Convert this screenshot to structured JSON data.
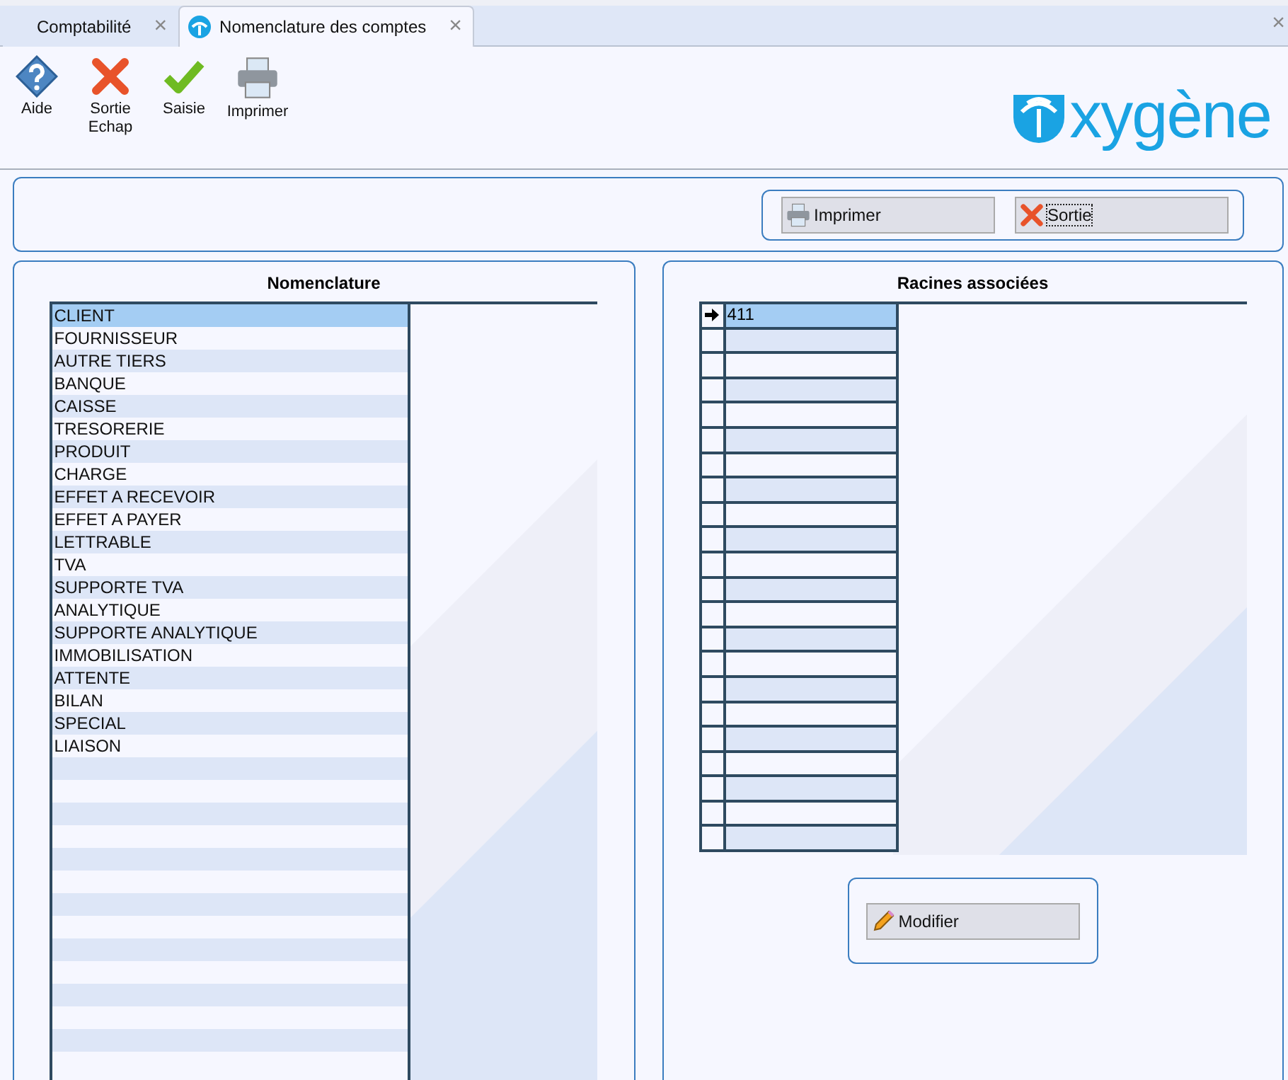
{
  "tabs": [
    {
      "label": "Comptabilité",
      "selected": false,
      "close": "×"
    },
    {
      "label": "Nomenclature des comptes",
      "selected": true,
      "close": "×"
    }
  ],
  "window_close": "×",
  "toolbar": [
    {
      "kind": "help",
      "label": "Aide"
    },
    {
      "kind": "exit",
      "label": "Sortie\nEchap"
    },
    {
      "kind": "check",
      "label": "Saisie"
    },
    {
      "kind": "print",
      "label": "Imprimer"
    }
  ],
  "logo_text": "xygène",
  "top_buttons": [
    {
      "kind": "print",
      "label": "Imprimer",
      "focused": false
    },
    {
      "kind": "exit",
      "label": "Sortie",
      "focused": true
    }
  ],
  "nomenclature": {
    "title": "Nomenclature",
    "items": [
      {
        "label": "CLIENT",
        "selected": true
      },
      {
        "label": "FOURNISSEUR",
        "selected": false
      },
      {
        "label": "AUTRE TIERS",
        "selected": false
      },
      {
        "label": "BANQUE",
        "selected": false
      },
      {
        "label": "CAISSE",
        "selected": false
      },
      {
        "label": "TRESORERIE",
        "selected": false
      },
      {
        "label": "PRODUIT",
        "selected": false
      },
      {
        "label": "CHARGE",
        "selected": false
      },
      {
        "label": "EFFET A RECEVOIR",
        "selected": false
      },
      {
        "label": "EFFET A PAYER",
        "selected": false
      },
      {
        "label": "LETTRABLE",
        "selected": false
      },
      {
        "label": "TVA",
        "selected": false
      },
      {
        "label": "SUPPORTE TVA",
        "selected": false
      },
      {
        "label": "ANALYTIQUE",
        "selected": false
      },
      {
        "label": "SUPPORTE ANALYTIQUE",
        "selected": false
      },
      {
        "label": "IMMOBILISATION",
        "selected": false
      },
      {
        "label": "ATTENTE",
        "selected": false
      },
      {
        "label": "BILAN",
        "selected": false
      },
      {
        "label": "SPECIAL",
        "selected": false
      },
      {
        "label": "LIAISON",
        "selected": false
      }
    ]
  },
  "racines": {
    "title": "Racines associées",
    "rows": [
      {
        "value": "411",
        "selected": true
      }
    ]
  },
  "modify_button": {
    "label": "Modifier"
  }
}
